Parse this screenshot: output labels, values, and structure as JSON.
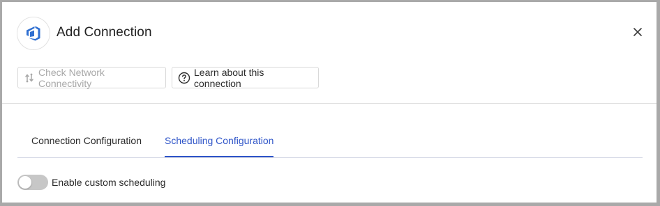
{
  "dialog": {
    "title": "Add Connection",
    "logo_icon": "azure-devops-logo",
    "close_icon": "close-icon"
  },
  "toolbar": {
    "check_network_label": "Check Network Connectivity",
    "check_network_icon": "network-connectivity-icon",
    "check_network_disabled": true,
    "learn_label": "Learn about this connection",
    "learn_icon": "help-circle-icon"
  },
  "tabs": [
    {
      "label": "Connection Configuration",
      "active": false
    },
    {
      "label": "Scheduling Configuration",
      "active": true
    }
  ],
  "scheduling": {
    "toggle_label": "Enable custom scheduling",
    "enabled": false
  },
  "colors": {
    "accent": "#2f55c8",
    "logo_blue": "#2f6fd1",
    "disabled_text": "#a8a8a8",
    "toggle_off": "#c7c7c7"
  }
}
